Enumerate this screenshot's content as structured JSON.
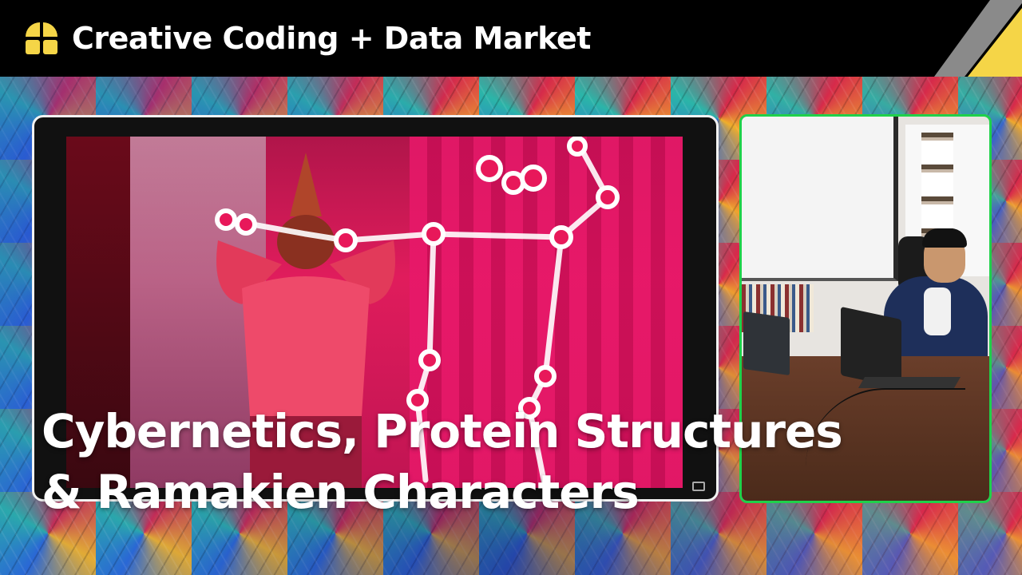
{
  "header": {
    "title": "Creative Coding + Data Market"
  },
  "title_overlay": {
    "line1": "Cybernetics, Protein Structures",
    "line2": "& Ramakien Characters"
  },
  "colors": {
    "header_bg": "#000000",
    "logo_yellow": "#f5d547",
    "corner_yellow": "#f5d547",
    "corner_grey": "#8a8a8a",
    "webcam_border": "#1fd14a",
    "main_video_border": "#f2f2f2",
    "skeleton_white": "#ffffff"
  },
  "icons": {
    "logo": "quadrant-logo-icon",
    "fullscreen": "fullscreen-icon"
  }
}
